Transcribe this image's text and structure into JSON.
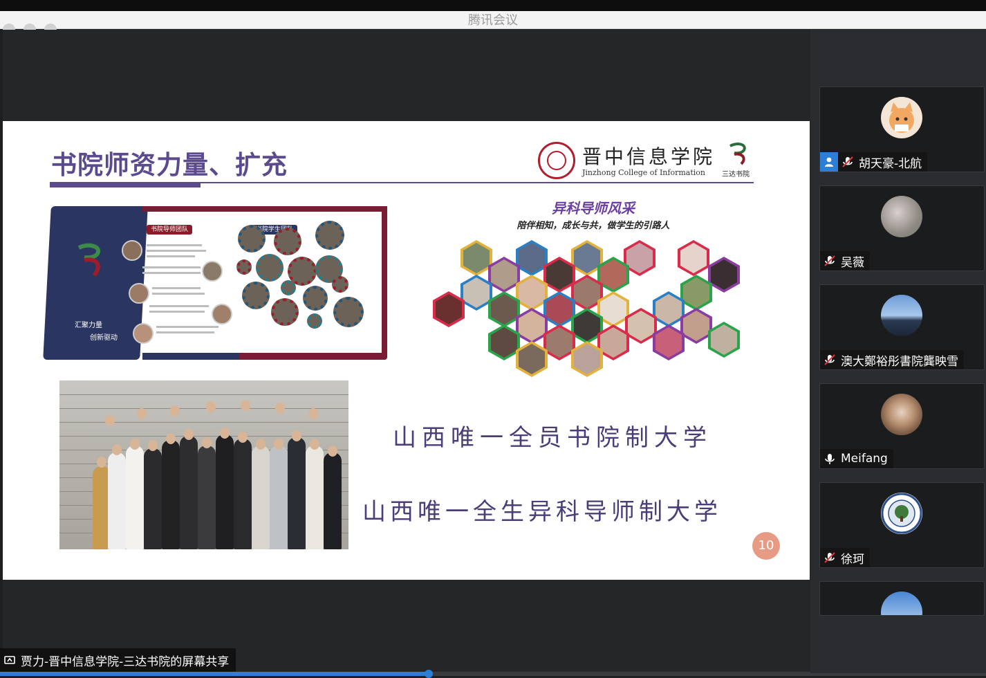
{
  "window": {
    "title": "腾讯会议"
  },
  "slide": {
    "title": "书院师资力量、扩充",
    "college_logo_cn": "晋中信息学院",
    "college_logo_en": "Jinzhong College of Information",
    "academy_logo_text": "三达书院",
    "board": {
      "caption_left": "书院导师团队",
      "caption_right": "书院学生团队",
      "slogan_line1": "汇聚力量",
      "slogan_line2": "创新驱动"
    },
    "mentor_section_title": "异科导师风采",
    "mentor_section_subtitle": "陪伴相知，成长与共，做学生的引路人",
    "calligraphy_line1": "山西唯一全员书院制大学",
    "calligraphy_line2": "山西唯一全生异科导师制大学",
    "page_number": "10"
  },
  "screen_share": {
    "label": "贾力-晋中信息学院-三达书院的屏幕共享"
  },
  "playback": {
    "progress_fraction": 0.435
  },
  "participants": [
    {
      "name": "胡天豪-北航",
      "is_self": true,
      "mic": "muted",
      "avatar": "cat-avatar"
    },
    {
      "name": "吴薇",
      "is_self": false,
      "mic": "muted",
      "avatar": "blossom-avatar"
    },
    {
      "name": "澳大鄭裕彤書院龔映雪",
      "is_self": false,
      "mic": "muted",
      "avatar": "sky-avatar"
    },
    {
      "name": "Meifang",
      "is_self": false,
      "mic": "on",
      "avatar": "portrait-avatar"
    },
    {
      "name": "徐珂",
      "is_self": false,
      "mic": "muted",
      "avatar": "university-seal-avatar"
    },
    {
      "name": "",
      "is_self": false,
      "mic": "muted",
      "avatar": "mountain-avatar"
    }
  ],
  "colors": {
    "accent_blue": "#2c7ed6",
    "slide_purple": "#5b4a8d",
    "board_navy": "#2a3561",
    "board_maroon": "#7b1b35",
    "page_badge": "#e79b85"
  }
}
